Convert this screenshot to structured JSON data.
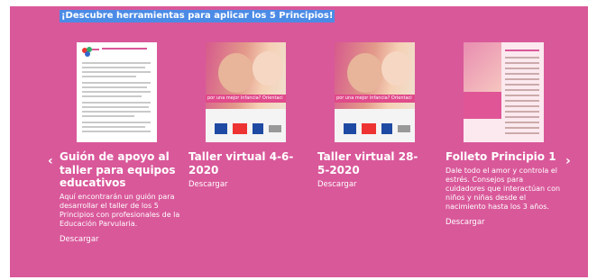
{
  "header": {
    "text": "¡Descubre herramientas para aplicar los 5 Principios!"
  },
  "nav": {
    "prev_glyph": "‹",
    "next_glyph": "›"
  },
  "cards": [
    {
      "title": "Guión de apoyo al taller para equipos educativos",
      "description": "Aquí encontrarán un guión para desarrollar el taller de los 5 Principios con profesionales de la Educación Parvularia.",
      "download": "Descargar",
      "thumb": "document-page"
    },
    {
      "title": "Taller virtual 4-6-2020",
      "description": "",
      "download": "Descargar",
      "thumb": "mother-baby-flyer",
      "thumb_text": "por una mejor infancia? Orientaci"
    },
    {
      "title": "Taller virtual 28-5-2020",
      "description": "",
      "download": "Descargar",
      "thumb": "mother-baby-flyer",
      "thumb_text": "por una mejor infancia? Orientaci"
    },
    {
      "title": "Folleto Principio 1",
      "description": "Dale todo el amor y controla el estrés. Consejos para cuidadores que interactúan con niños y niñas desde el nacimiento hasta los 3 años.",
      "download": "Descargar",
      "thumb": "brochure"
    }
  ],
  "colors": {
    "panel": "#d9589a",
    "header_highlight": "#4b8be6",
    "text": "#ffffff"
  }
}
